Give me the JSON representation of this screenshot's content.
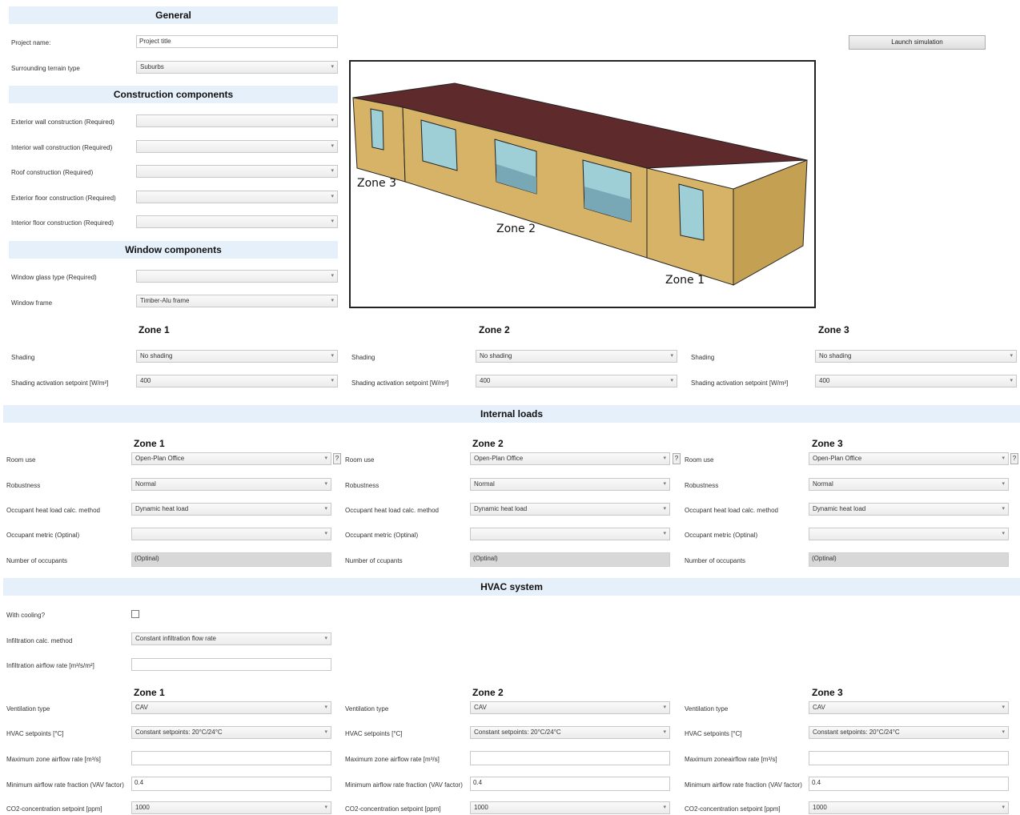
{
  "general": {
    "title": "General",
    "project_name_label": "Project name:",
    "project_name_value": "Project title",
    "terrain_label": "Surrounding terrain type",
    "terrain_value": "Suburbs"
  },
  "launch_button": "Launch simulation",
  "construction": {
    "title": "Construction components",
    "rows": [
      {
        "label": "Exterior wall construction (Required)",
        "value": ""
      },
      {
        "label": "Interior wall construction (Required)",
        "value": ""
      },
      {
        "label": "Roof construction (Required)",
        "value": ""
      },
      {
        "label": "Exterior floor construction (Required)",
        "value": ""
      },
      {
        "label": "Interior floor construction (Required)",
        "value": ""
      }
    ]
  },
  "window": {
    "title": "Window components",
    "glass_label": "Window glass type (Required)",
    "glass_value": "",
    "frame_label": "Window frame",
    "frame_value": "Timber-Alu frame"
  },
  "model": {
    "zone1": "Zone 1",
    "zone2": "Zone 2",
    "zone3": "Zone 3",
    "colors": {
      "roof": "#5e2a2c",
      "wall": "#d6b366",
      "wall_dark": "#c4a052",
      "glass": "#9ecfd6"
    }
  },
  "shading": {
    "zones": [
      {
        "title": "Zone 1",
        "shading_label": "Shading",
        "shading_value": "No shading",
        "setpoint_label": "Shading activation setpoint [W/m²]",
        "setpoint_value": "400"
      },
      {
        "title": "Zone 2",
        "shading_label": "Shading",
        "shading_value": "No shading",
        "setpoint_label": "Shading activation setpoint [W/m²]",
        "setpoint_value": "400"
      },
      {
        "title": "Zone 3",
        "shading_label": "Shading",
        "shading_value": "No shading",
        "setpoint_label": "Shading activation setpoint [W/m²]",
        "setpoint_value": "400"
      }
    ]
  },
  "internal_loads": {
    "title": "Internal loads",
    "zones": [
      {
        "title": "Zone 1",
        "room_use_label": "Room use",
        "room_use_value": "Open-Plan Office",
        "help": "?",
        "robustness_label": "Robustness",
        "robustness_value": "Normal",
        "heat_label": "Occupant heat load calc. method",
        "heat_value": "Dynamic heat load",
        "metric_label": "Occupant metric (Optinal)",
        "metric_value": "",
        "occupants_label": "Number of occupants",
        "occupants_placeholder": "(Optinal)"
      },
      {
        "title": "Zone 2",
        "room_use_label": "Room use",
        "room_use_value": "Open-Plan Office",
        "help": "?",
        "robustness_label": "Robustness",
        "robustness_value": "Normal",
        "heat_label": "Occupant heat load calc. method",
        "heat_value": "Dynamic heat load",
        "metric_label": "Occupant metric (Optinal)",
        "metric_value": "",
        "occupants_label": "Number of ccupants",
        "occupants_placeholder": "(Optinal)"
      },
      {
        "title": "Zone 3",
        "room_use_label": "Room use",
        "room_use_value": "Open-Plan Office",
        "help": "?",
        "robustness_label": "Robustness",
        "robustness_value": "Normal",
        "heat_label": "Occupant heat load calc. method",
        "heat_value": "Dynamic heat load",
        "metric_label": "Occupant metric (Optinal)",
        "metric_value": "",
        "occupants_label": "Number of occupants",
        "occupants_placeholder": "(Optinal)"
      }
    ]
  },
  "hvac": {
    "title": "HVAC system",
    "cooling_label": "With cooling?",
    "infiltration_label": "Infiltration calc. method",
    "infiltration_value": "Constant infiltration flow rate",
    "airflow_label": "Infiltration airflow rate [m³/s/m²]",
    "airflow_value": "",
    "zones": [
      {
        "title": "Zone 1",
        "vent_label": "Ventilation type",
        "vent_value": "CAV",
        "setp_label": "HVAC setpoints [°C]",
        "setp_value": "Constant setpoints: 20°C/24°C",
        "max_label": "Maximum zone airflow rate [m³/s]",
        "max_value": "",
        "min_label": "Minimum airflow rate fraction (VAV factor)",
        "min_value": "0.4",
        "co2_label": "CO2-concentration setpoint [ppm]",
        "co2_value": "1000"
      },
      {
        "title": "Zone 2",
        "vent_label": "Ventilation type",
        "vent_value": "CAV",
        "setp_label": "HVAC setpoints [°C]",
        "setp_value": "Constant setpoints: 20°C/24°C",
        "max_label": "Maximum zone airflow rate [m³/s]",
        "max_value": "",
        "min_label": "Minimum airflow rate fraction (VAV factor)",
        "min_value": "0.4",
        "co2_label": "CO2-concentration setpoint [ppm]",
        "co2_value": "1000"
      },
      {
        "title": "Zone 3",
        "vent_label": "Ventilation type",
        "vent_value": "CAV",
        "setp_label": "HVAC setpoints [°C]",
        "setp_value": "Constant setpoints: 20°C/24°C",
        "max_label": "Maximum zoneairflow rate [m³/s]",
        "max_value": "",
        "min_label": "Minimum airflow rate fraction (VAV factor)",
        "min_value": "0.4",
        "co2_label": "CO2-concentration setpoint [ppm]",
        "co2_value": "1000"
      }
    ]
  }
}
